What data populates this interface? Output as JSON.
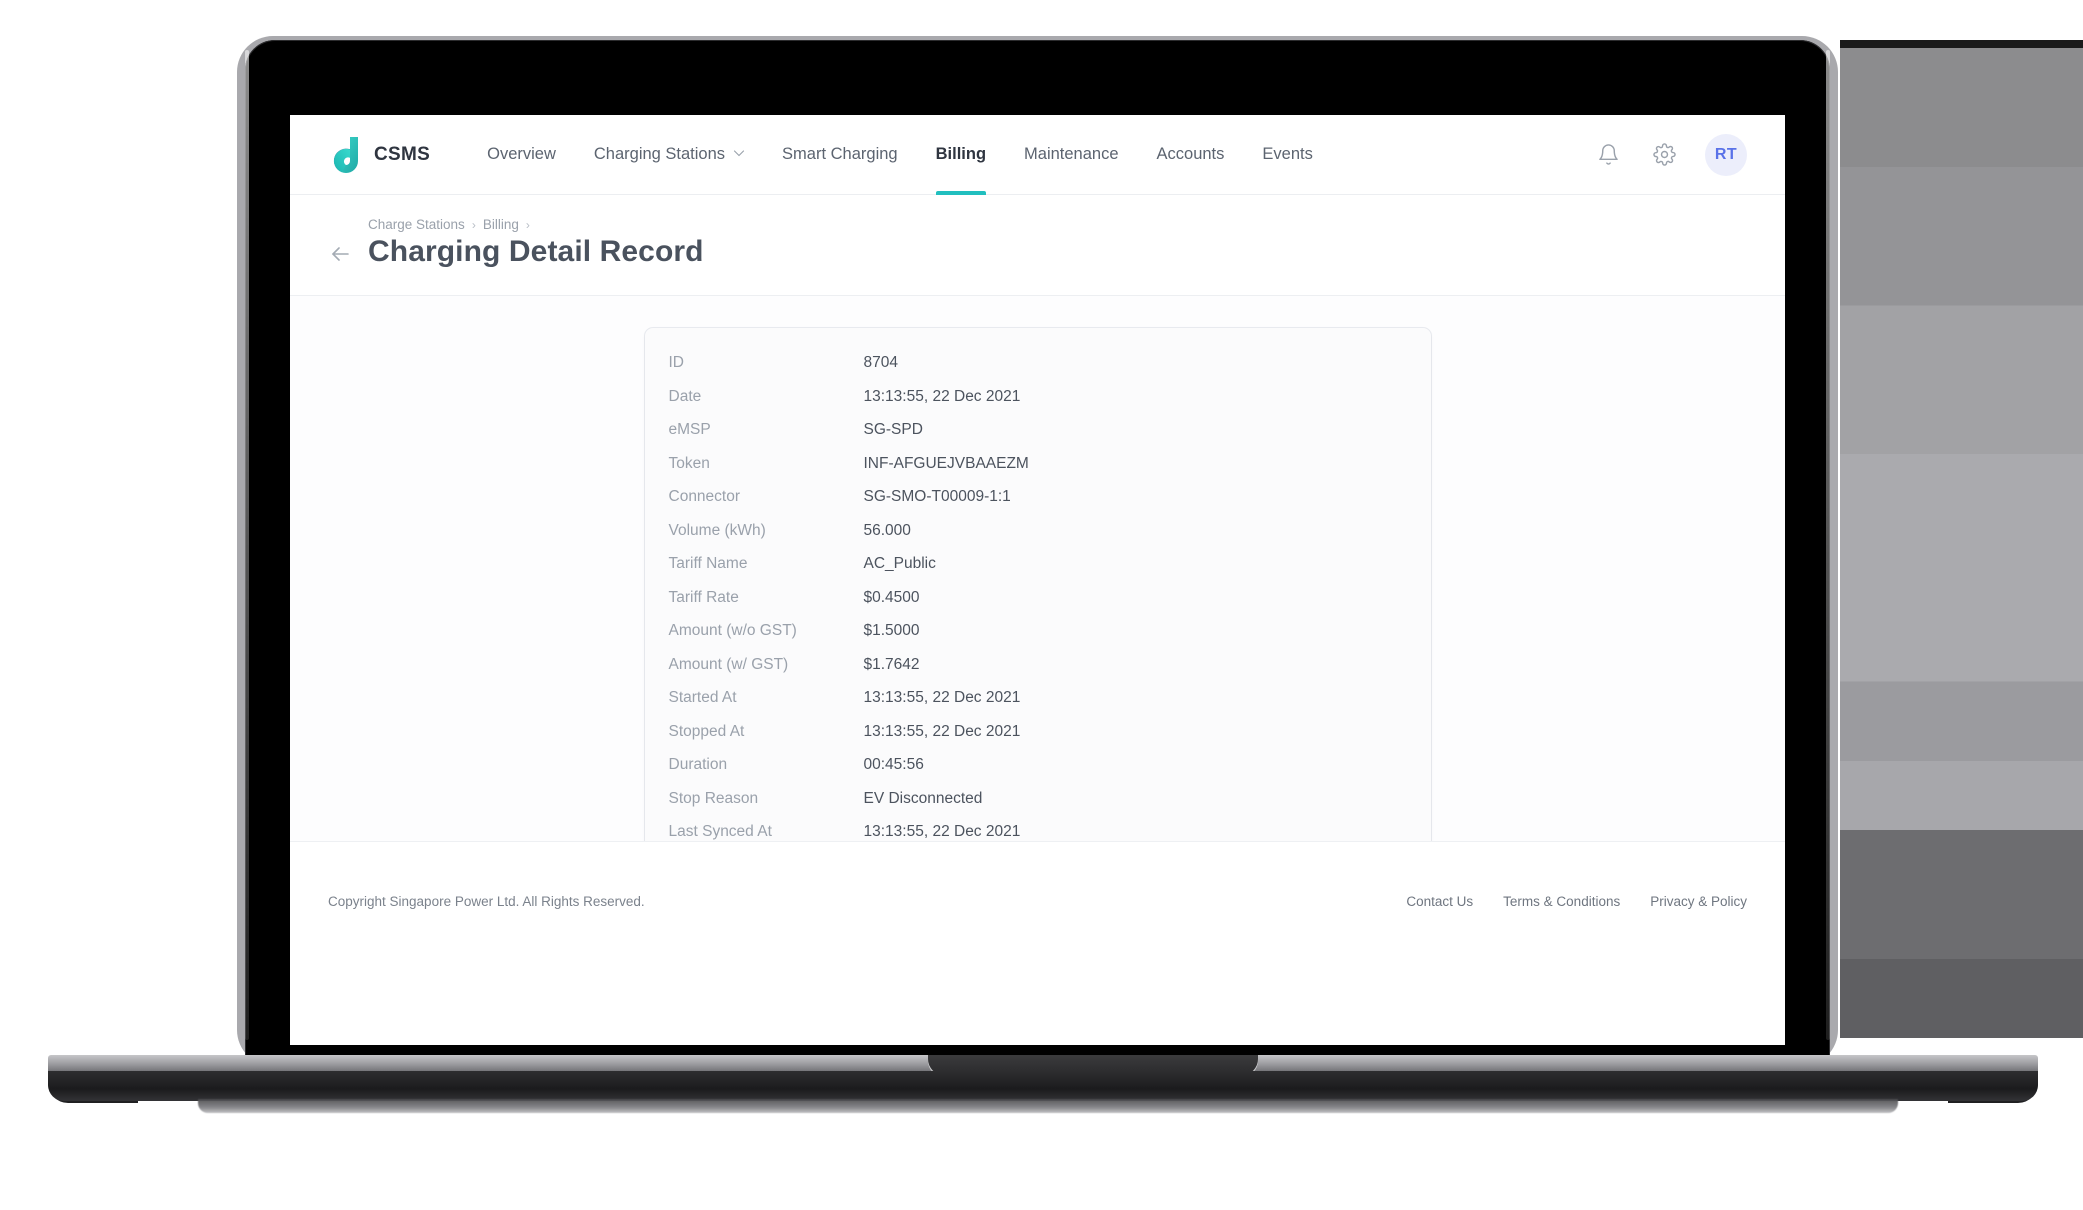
{
  "brand": {
    "name": "CSMS",
    "logo_icon": "csms-d-logo",
    "accent": "#21bfbf"
  },
  "nav": {
    "items": [
      {
        "label": "Overview",
        "icon": "",
        "active": false
      },
      {
        "label": "Charging Stations",
        "icon": "chevron-down-icon",
        "active": false
      },
      {
        "label": "Smart Charging",
        "icon": "",
        "active": false
      },
      {
        "label": "Billing",
        "icon": "",
        "active": true
      },
      {
        "label": "Maintenance",
        "icon": "",
        "active": false
      },
      {
        "label": "Accounts",
        "icon": "",
        "active": false
      },
      {
        "label": "Events",
        "icon": "",
        "active": false
      }
    ],
    "notification_icon": "bell-icon",
    "settings_icon": "gear-icon",
    "avatar_initials": "RT",
    "avatar_color": "#5a72e8"
  },
  "header": {
    "back_icon": "arrow-left-icon",
    "breadcrumbs": [
      "Charge Stations",
      "Billing"
    ],
    "separator": "›",
    "title": "Charging Detail Record"
  },
  "detail": {
    "rows": [
      {
        "label": "ID",
        "value": "8704"
      },
      {
        "label": "Date",
        "value": "13:13:55, 22 Dec 2021"
      },
      {
        "label": "eMSP",
        "value": "SG-SPD"
      },
      {
        "label": "Token",
        "value": " INF-AFGUEJVBAAEZM"
      },
      {
        "label": "Connector",
        "value": "SG-SMO-T00009-1:1"
      },
      {
        "label": "Volume (kWh)",
        "value": "56.000"
      },
      {
        "label": "Tariff Name",
        "value": "AC_Public"
      },
      {
        "label": "Tariff Rate",
        "value": "$0.4500"
      },
      {
        "label": "Amount (w/o GST)",
        "value": " $1.5000"
      },
      {
        "label": "Amount (w/ GST)",
        "value": "$1.7642"
      },
      {
        "label": "Started At",
        "value": "13:13:55, 22 Dec 2021"
      },
      {
        "label": "Stopped At",
        "value": "13:13:55, 22 Dec 2021"
      },
      {
        "label": "Duration",
        "value": " 00:45:56"
      },
      {
        "label": "Stop Reason",
        "value": " EV Disconnected"
      },
      {
        "label": "Last Synced At",
        "value": "13:13:55, 22 Dec 2021"
      }
    ]
  },
  "footer": {
    "copyright": "Copyright Singapore Power Ltd. All Rights Reserved.",
    "links": [
      "Contact Us",
      "Terms & Conditions",
      "Privacy & Policy"
    ]
  }
}
